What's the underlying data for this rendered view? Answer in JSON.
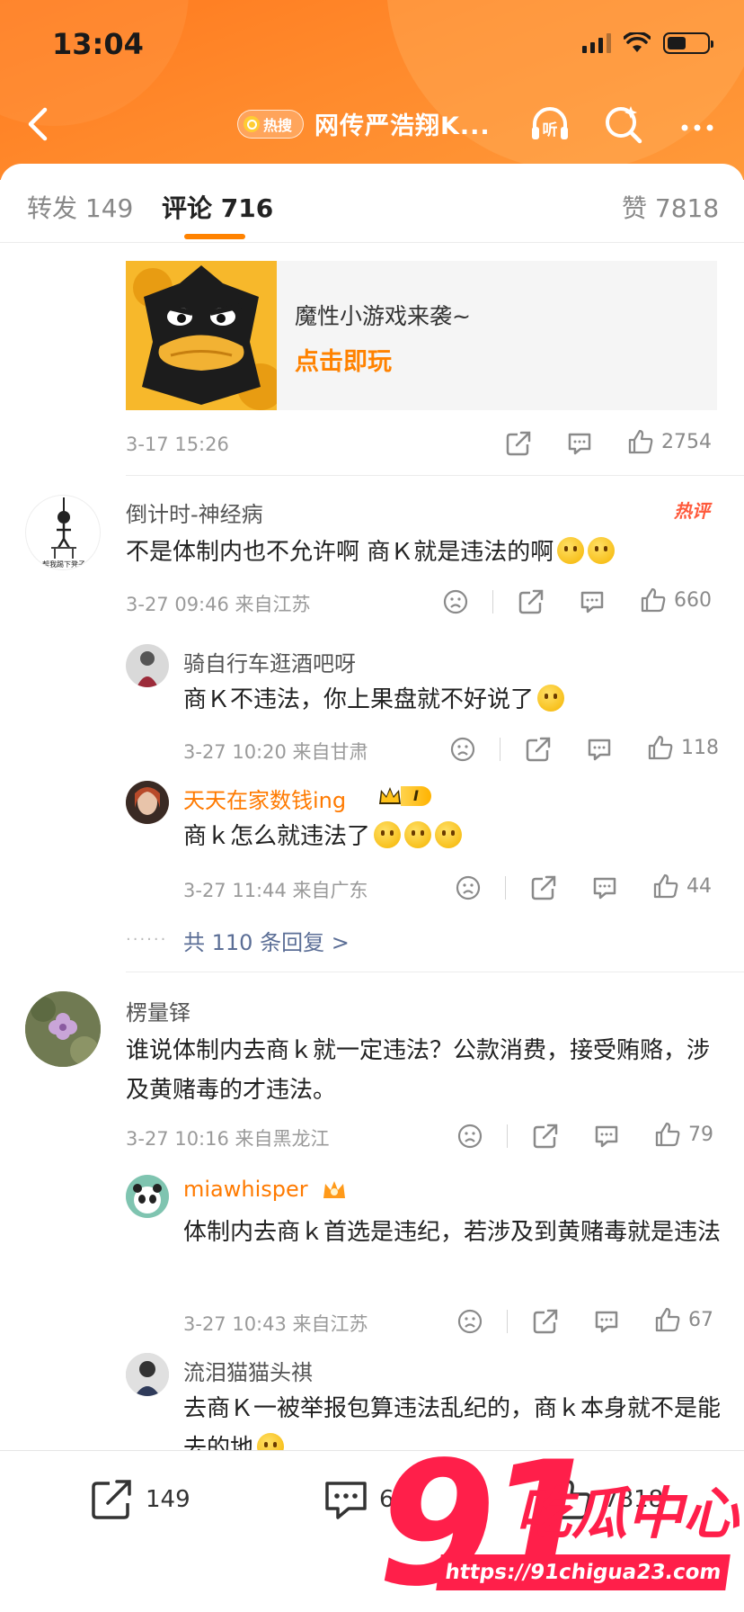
{
  "status_bar": {
    "time": "13:04"
  },
  "nav": {
    "hot_badge": "热搜",
    "title": "网传严浩翔K...",
    "listen_label": "听"
  },
  "tabs": {
    "repost": "转发 149",
    "comment": "评论 716",
    "like": "赞 7818"
  },
  "ad": {
    "line1": "魔性小游戏来袭~",
    "line2": "点击即玩",
    "time": "3-17 15:26",
    "likes": "2754"
  },
  "comments": [
    {
      "user": "倒计时-神经病",
      "avatar_caption": "帮我踢下凳子",
      "hot_label": "热评",
      "text": "不是体制内也不允许啊 商Ｋ就是违法的啊",
      "meta": "3-27 09:46  来自江苏",
      "likes": "660",
      "replies": [
        {
          "user": "骑自行车逛酒吧呀",
          "text": "商Ｋ不违法，你上果盘就不好说了",
          "meta": "3-27 10:20  来自甘肃",
          "likes": "118"
        },
        {
          "user": "天天在家数钱ing",
          "level_badge": "I",
          "text": "商ｋ怎么就违法了",
          "meta": "3-27 11:44  来自广东",
          "likes": "44"
        }
      ],
      "more_replies": "共 110 条回复 >"
    },
    {
      "user": "楞量铎",
      "text": "谁说体制内去商ｋ就一定违法？公款消费，接受贿赂，涉及黄赌毒的才违法。",
      "meta": "3-27 10:16  来自黑龙江",
      "likes": "79",
      "replies": [
        {
          "user": "miawhisper",
          "text": "体制内去商ｋ首选是违纪，若涉及到黄赌毒就是违法",
          "meta": "3-27 10:43  来自江苏",
          "likes": "67"
        },
        {
          "user": "流泪猫猫头祺",
          "text": "去商Ｋ一被举报包算违法乱纪的，商ｋ本身就不是能去的地"
        }
      ]
    }
  ],
  "bottom_bar": {
    "repost": "149",
    "comment": "6",
    "like": "7818"
  },
  "watermark": {
    "number": "91",
    "name": "吃瓜中心",
    "url": "https://91chigua23.com"
  },
  "colors": {
    "brand_orange": "#ff8200",
    "header_orange": "#ff7a1f",
    "link_blue": "#5b6e96",
    "watermark_red": "#ff1f4a"
  }
}
